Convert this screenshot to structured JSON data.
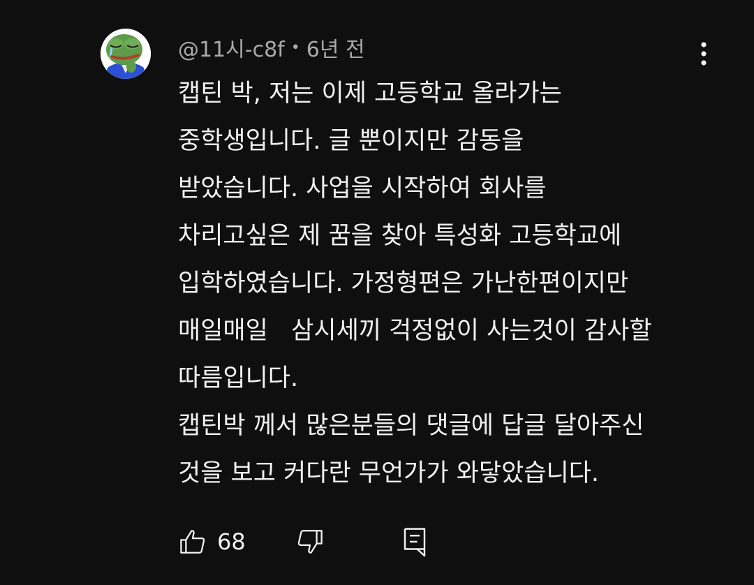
{
  "comment": {
    "author": "@11시-c8f",
    "separator": "•",
    "time": "6년 전",
    "avatar_icon": "pepe-frog-avatar-icon",
    "menu_icon": "more-vertical-icon",
    "lines": [
      "캡틴 박, 저는 이제 고등학교 올라가는",
      "중학생입니다. 글 뿐이지만 감동을",
      "받았습니다. 사업을 시작하여 회사를",
      "차리고싶은 제 꿈을 찾아 특성화 고등학교에",
      "입학하였습니다. 가정형편은 가난한편이지만",
      "매일매일   삼시세끼 걱정없이 사는것이 감사할",
      "따름입니다.",
      "캡틴박 께서 많은분들의 댓글에 답글 달아주신",
      "것을 보고 커다란 무언가가 와닿았습니다."
    ],
    "actions": {
      "like_icon": "thumbs-up-icon",
      "like_count": "68",
      "dislike_icon": "thumbs-down-icon",
      "reply_icon": "reply-comment-icon"
    }
  },
  "colors": {
    "background": "#0f0f0f",
    "text": "#f1f1f1",
    "meta": "#aaaaaa"
  }
}
